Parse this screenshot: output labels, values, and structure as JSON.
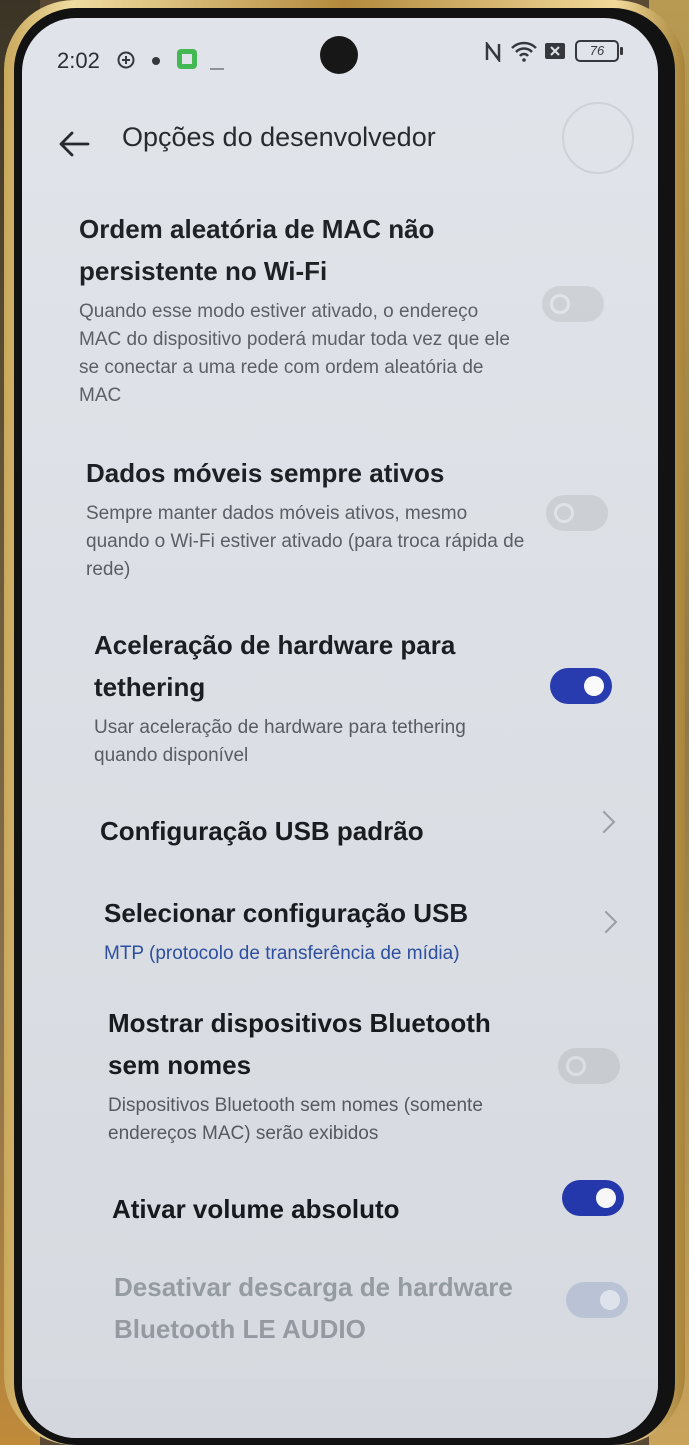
{
  "status_bar": {
    "time": "2:02",
    "battery": "76"
  },
  "header": {
    "title": "Opções do desenvolvedor"
  },
  "settings": [
    {
      "title": "Ordem aleatória de MAC não persistente no Wi-Fi",
      "description": "Quando esse modo estiver ativado, o endereço MAC do dispositivo poderá mudar toda vez que ele se conectar a uma rede com ordem aleatória de MAC",
      "control": "toggle",
      "enabled": false
    },
    {
      "title": "Dados móveis sempre ativos",
      "description": "Sempre manter dados móveis ativos, mesmo quando o Wi-Fi estiver ativado (para troca rápida de rede)",
      "control": "toggle",
      "enabled": false
    },
    {
      "title": "Aceleração de hardware para tethering",
      "description": "Usar aceleração de hardware para tethering quando disponível",
      "control": "toggle",
      "enabled": true
    },
    {
      "title": "Configuração USB padrão",
      "control": "chevron"
    },
    {
      "title": "Selecionar configuração USB",
      "description": "MTP (protocolo de transferência de mídia)",
      "control": "chevron"
    },
    {
      "title": "Mostrar dispositivos Bluetooth sem nomes",
      "description": "Dispositivos Bluetooth sem nomes (somente endereços MAC) serão exibidos",
      "control": "toggle",
      "enabled": false
    },
    {
      "title": "Ativar volume absoluto",
      "control": "toggle",
      "enabled": true
    },
    {
      "title": "Desativar descarga de hardware Bluetooth LE AUDIO",
      "control": "toggle",
      "enabled": true,
      "disabled": true
    }
  ],
  "colors": {
    "accent": "#2337b0",
    "screen_bg": "#dfe3e9",
    "link": "#2b4ea2"
  }
}
